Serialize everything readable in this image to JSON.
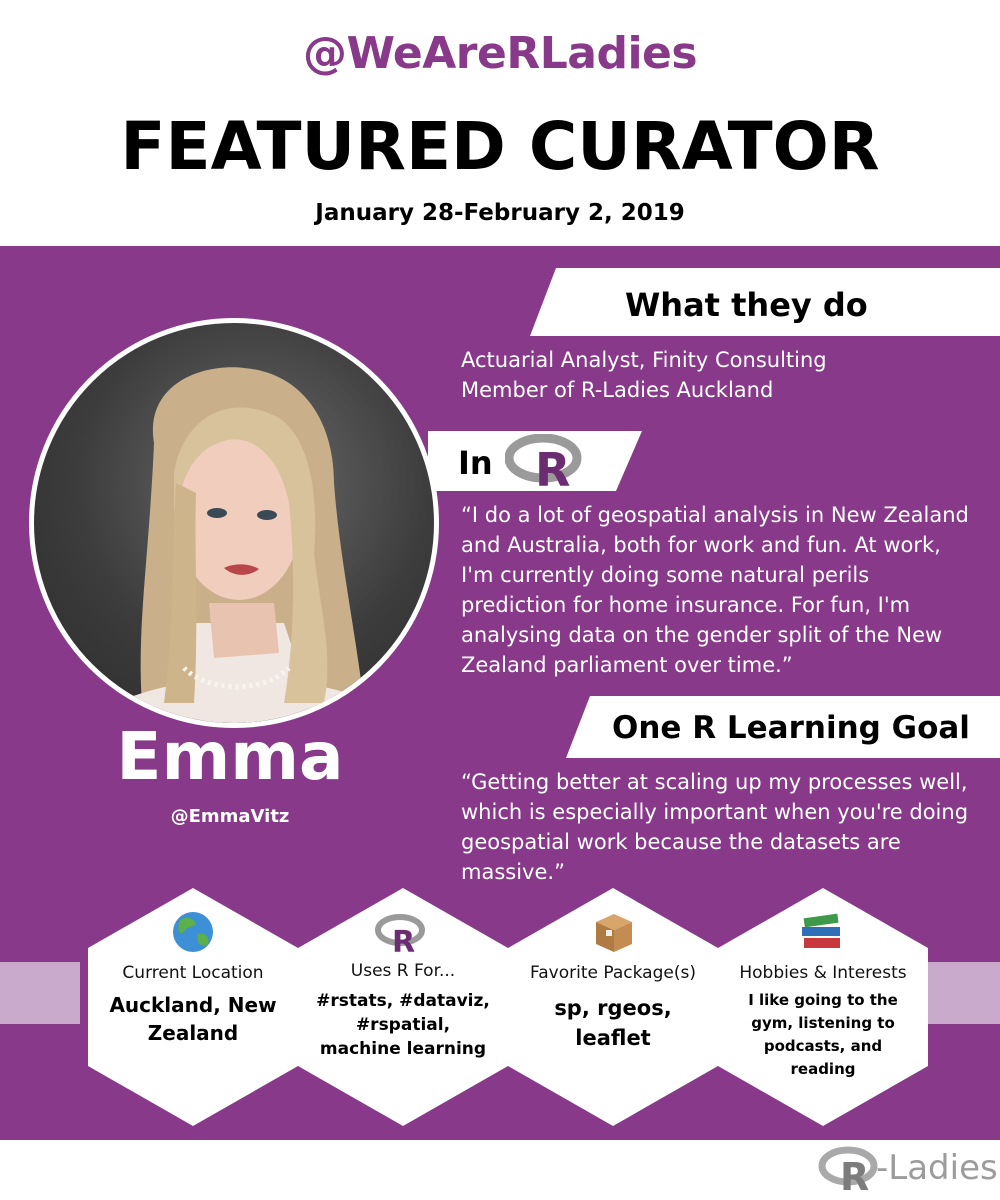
{
  "header": {
    "handle": "@WeAreRLadies",
    "title": "FEATURED CURATOR",
    "dates": "January 28-February 2, 2019"
  },
  "what_they_do": {
    "heading": "What they do",
    "lines": [
      "Actuarial Analyst, Finity Consulting",
      "Member of R-Ladies Auckland"
    ]
  },
  "in_r": {
    "heading": "In",
    "logo_letter": "R",
    "quote_lines": [
      "“I do a lot of geospatial analysis in New Zealand",
      "and Australia, both for work and fun. At work,",
      "I'm currently doing some natural perils",
      "prediction for home insurance. For fun, I'm",
      "analysing data on the gender split of the New",
      "Zealand parliament over time.”"
    ]
  },
  "learning_goal": {
    "heading": "One R Learning Goal",
    "quote_lines": [
      "“Getting better at scaling up my processes well,",
      "which is especially important when you're doing",
      "geospatial work because the datasets are",
      "massive.”"
    ]
  },
  "curator": {
    "name": "Emma",
    "twitter": "@EmmaVitz"
  },
  "hexagons": [
    {
      "icon": "globe-icon",
      "label": "Current Location",
      "value_lines": [
        "Auckland, New",
        "Zealand"
      ]
    },
    {
      "icon": "r-logo-icon",
      "label": "Uses R For...",
      "value_lines": [
        "#rstats, #dataviz,",
        "#rspatial,",
        "machine learning"
      ]
    },
    {
      "icon": "package-icon",
      "label": "Favorite Package(s)",
      "value_lines": [
        "sp, rgeos,",
        "leaflet"
      ]
    },
    {
      "icon": "books-icon",
      "label": "Hobbies & Interests",
      "value_lines": [
        "I like going to the",
        "gym, listening to",
        "podcasts, and",
        "reading"
      ]
    }
  ],
  "footer": {
    "logo_letter": "R",
    "brand": "-Ladies"
  },
  "colors": {
    "purple": "#88398a",
    "light_purple": "#c9a9cc",
    "white": "#ffffff"
  }
}
